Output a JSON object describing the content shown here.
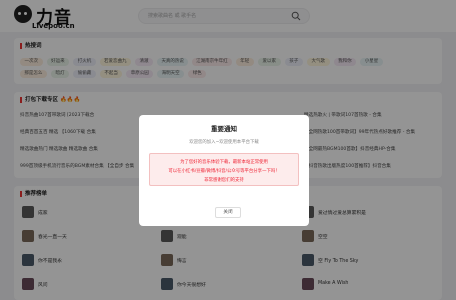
{
  "header": {
    "logo_title": "力音",
    "logo_sub": "Livepoo.cn",
    "search_placeholder": "搜索歌曲名 或 歌手名"
  },
  "hot": {
    "title": "热搜词",
    "tags_row1": [
      "一次次",
      "好运来",
      "打火机",
      "若爱恋曲九",
      "清澈",
      "天真的热说",
      "江湖南京牛年红",
      "年轻",
      "爱以家",
      "孩子",
      "大气歌",
      "我和你",
      "小星星"
    ],
    "tags_row2": [
      "那是怎么",
      "暗灯",
      "偷偷藏",
      "不起当",
      "草原公园",
      "海明天空",
      "绿色"
    ]
  },
  "packages": {
    "title": "打包下载专区",
    "lines_left": [
      "抖音热曲107首带歌词 [2023下载合",
      "经典百首五百 精选 【1060下载 合集",
      "精选歌曲热门 精选歌曲 精选歌曲 合集",
      "999首顶级手机流行音乐的BGM素材合集 【全自步 合集"
    ],
    "lines_right": [
      "精选热歌火 | 带歌词107首热歌 - 合集",
      "【全网热歌100首带歌词】99年代热点好歌推荐 - 合集",
      "【全网最热BGM100首歌】抖音经典HP-合集",
      "【抖音热歌出版热度100首推荐】抖音合集"
    ]
  },
  "recommend": {
    "title": "推荐榜单",
    "col1": [
      "成家",
      "春光一直一天",
      "你不是我永",
      "风问"
    ],
    "col2": [
      "",
      "观能",
      "悔言",
      "你今天很想好"
    ],
    "col3": [
      "爱过情过爱总算累积是",
      "空空",
      "空 Fly To The Sky",
      "Make A Wish"
    ]
  },
  "modal": {
    "title": "重要通知",
    "subtitle": "欢迎您的加入~欢迎使用本平台下载",
    "line1": "为了您好的音乐体验下载，最新本站正常使用",
    "line2": "可以在小红书/豆瓣/微博/抖音/公众号等平台分享一下吗！",
    "line3": "非常感谢您们的支持",
    "button": "关闭"
  },
  "colors": {
    "accent": "#e22233",
    "overlay": "rgba(0,0,0,0.42)"
  }
}
